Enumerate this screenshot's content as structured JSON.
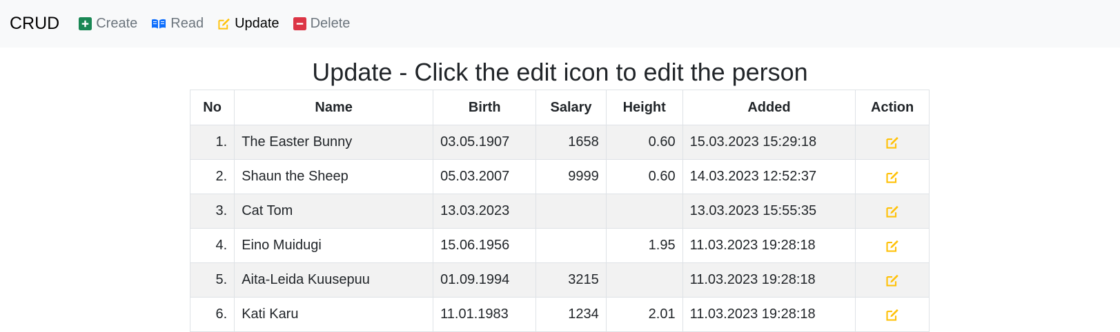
{
  "nav": {
    "brand": "CRUD",
    "items": [
      {
        "label": "Create",
        "icon": "plus-square-icon",
        "color": "#198754"
      },
      {
        "label": "Read",
        "icon": "book-icon",
        "color": "#0d6efd"
      },
      {
        "label": "Update",
        "icon": "pencil-square-icon",
        "color": "#ffc107"
      },
      {
        "label": "Delete",
        "icon": "minus-square-icon",
        "color": "#dc3545"
      }
    ],
    "active": "Update"
  },
  "page": {
    "title": "Update - Click the edit icon to edit the person"
  },
  "table": {
    "headers": [
      "No",
      "Name",
      "Birth",
      "Salary",
      "Height",
      "Added",
      "Action"
    ],
    "rows": [
      {
        "no": "1.",
        "name": "The Easter Bunny",
        "birth": "03.05.1907",
        "salary": "1658",
        "height": "0.60",
        "added": "15.03.2023 15:29:18"
      },
      {
        "no": "2.",
        "name": "Shaun the Sheep",
        "birth": "05.03.2007",
        "salary": "9999",
        "height": "0.60",
        "added": "14.03.2023 12:52:37"
      },
      {
        "no": "3.",
        "name": "Cat Tom",
        "birth": "13.03.2023",
        "salary": "",
        "height": "",
        "added": "13.03.2023 15:55:35"
      },
      {
        "no": "4.",
        "name": "Eino Muidugi",
        "birth": "15.06.1956",
        "salary": "",
        "height": "1.95",
        "added": "11.03.2023 19:28:18"
      },
      {
        "no": "5.",
        "name": "Aita-Leida Kuusepuu",
        "birth": "01.09.1994",
        "salary": "3215",
        "height": "",
        "added": "11.03.2023 19:28:18"
      },
      {
        "no": "6.",
        "name": "Kati Karu",
        "birth": "11.01.1983",
        "salary": "1234",
        "height": "2.01",
        "added": "11.03.2023 19:28:18"
      }
    ],
    "action_icon": "edit-icon",
    "action_color": "#ffc107"
  }
}
